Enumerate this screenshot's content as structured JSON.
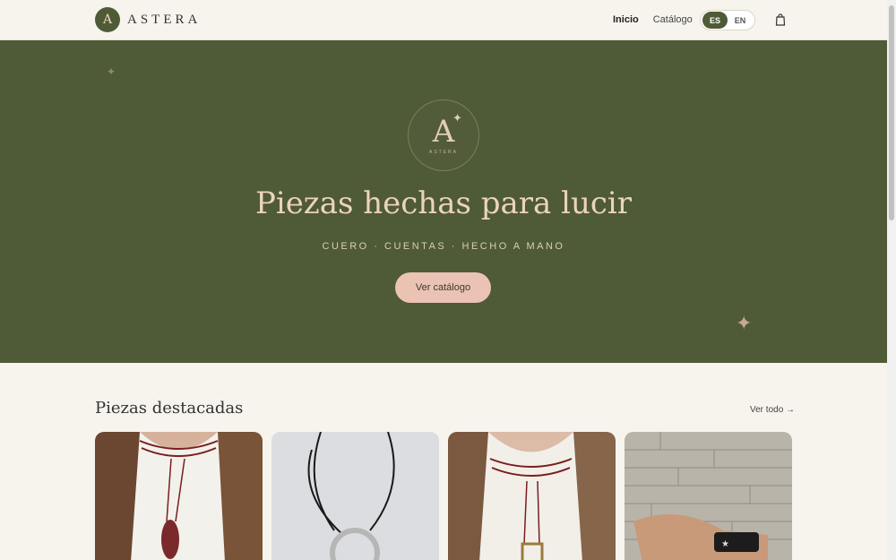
{
  "header": {
    "logo_mark": "A",
    "brand": "ASTERA",
    "nav": [
      "Inicio",
      "Catálogo"
    ],
    "languages": [
      "ES",
      "EN"
    ],
    "active_language": "ES"
  },
  "hero": {
    "emblem_letter": "A",
    "emblem_text": "ASTERA",
    "title": "Piezas hechas para lucir",
    "subtitle": "CUERO · CUENTAS · HECHO A MANO",
    "cta": "Ver catálogo"
  },
  "featured": {
    "title": "Piezas destacadas",
    "see_all": "Ver todo →"
  },
  "colors": {
    "brand_green": "#4f5a37",
    "accent_pink": "#ebc3b4",
    "background": "#f7f4ee"
  }
}
